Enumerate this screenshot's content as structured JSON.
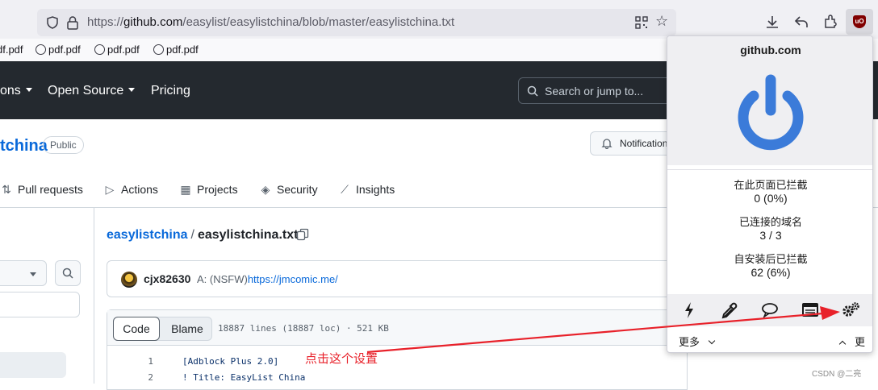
{
  "browser": {
    "url_prefix": "https://",
    "url_host": "github.com",
    "url_path": "/easylist/easylistchina/blob/master/easylistchina.txt",
    "bookmarks": [
      "df.pdf",
      "pdf.pdf",
      "pdf.pdf",
      "pdf.pdf"
    ],
    "ublock_badge": "uO"
  },
  "github": {
    "nav": [
      "ons",
      "Open Source",
      "Pricing"
    ],
    "search_placeholder": "Search or jump to...",
    "repo_name": "tchina",
    "visibility": "Public",
    "notifications_label": "Notification",
    "tabs": [
      "Pull requests",
      "Actions",
      "Projects",
      "Security",
      "Insights"
    ],
    "breadcrumb_repo": "easylistchina",
    "breadcrumb_sep": "/",
    "file_name": "easylistchina.txt",
    "commit_user": "cjx82630",
    "commit_prefix": "A: (NSFW)",
    "commit_link": "https://jmcomic.me/",
    "code_label": "Code",
    "blame_label": "Blame",
    "file_meta": "18887 lines (18887 loc) · 521 KB",
    "lines": [
      {
        "num": "1",
        "text": "[Adblock Plus 2.0]"
      },
      {
        "num": "2",
        "text": "! Title: EasyList China"
      }
    ]
  },
  "ublock": {
    "domain": "github.com",
    "stats": [
      {
        "label": "在此页面已拦截",
        "value": "0 (0%)"
      },
      {
        "label": "已连接的域名",
        "value": "3 / 3"
      },
      {
        "label": "自安装后已拦截",
        "value": "62 (6%)"
      }
    ],
    "tools": [
      "lightning-icon",
      "eyedropper-icon",
      "speech-bubble-icon",
      "logger-icon",
      "settings-gears-icon"
    ],
    "more_label": "更多",
    "less_label": "更少",
    "accent_color": "#3b7bd9"
  },
  "annotation": {
    "text": "点击这个设置",
    "color": "#e8212a"
  },
  "watermark": "CSDN @二亮"
}
